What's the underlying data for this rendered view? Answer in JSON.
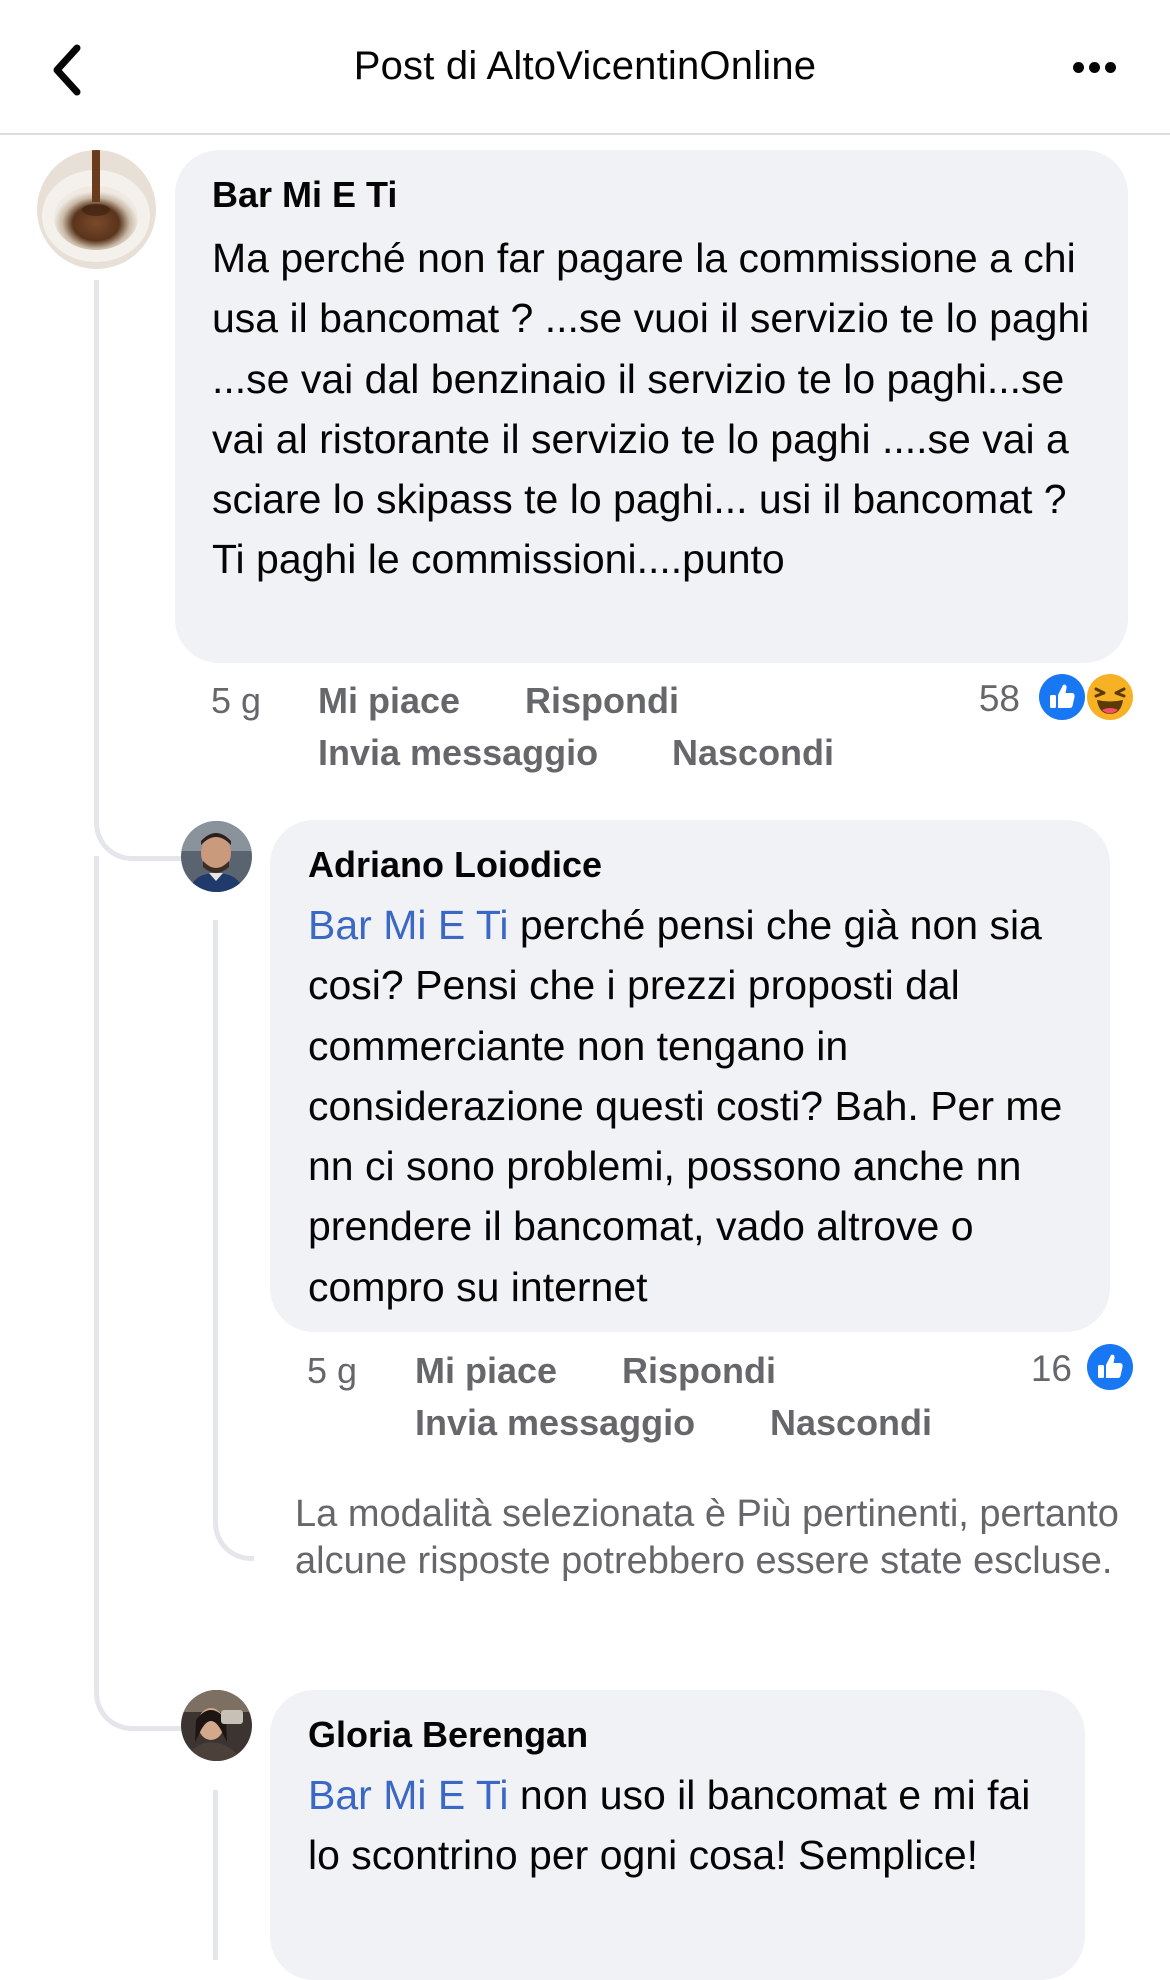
{
  "header": {
    "title": "Post di AltoVicentinOnline"
  },
  "comments": [
    {
      "author": "Bar Mi E Ti",
      "text": "Ma perché non far pagare la commissione a chi usa il bancomat ? ...se vuoi il servizio te lo paghi ...se vai dal benzinaio il servizio te lo paghi...se vai al ristorante il servizio te lo paghi ....se vai a sciare lo skipass te lo paghi... usi il bancomat ? Ti paghi le commissioni....punto",
      "time": "5 g",
      "like_label": "Mi piace",
      "reply_label": "Rispondi",
      "message_label": "Invia messaggio",
      "hide_label": "Nascondi",
      "reaction_count": "58",
      "reactions": [
        "like-icon",
        "haha-icon"
      ]
    },
    {
      "author": "Adriano Loiodice",
      "mention": "Bar Mi E Ti",
      "text": "perché pensi che già non sia cosi? Pensi che i prezzi proposti dal commerciante non tengano in considerazione questi costi? Bah. Per me nn ci sono problemi, possono anche nn prendere il bancomat, vado altrove o compro su internet",
      "time": "5 g",
      "like_label": "Mi piace",
      "reply_label": "Rispondi",
      "message_label": "Invia messaggio",
      "hide_label": "Nascondi",
      "reaction_count": "16",
      "reactions": [
        "like-icon"
      ]
    },
    {
      "author": "Gloria Berengan",
      "mention": "Bar Mi E Ti",
      "text": "non uso il bancomat e mi fai lo scontrino per ogni cosa! Semplice!"
    }
  ],
  "notice": "La modalità selezionata è Più pertinenti, pertanto alcune risposte potrebbero essere state escluse.",
  "colors": {
    "bubble": "#f0f2f5",
    "mention": "#3a68c4",
    "secondary_text": "#65676b",
    "like_blue": "#1877f2",
    "haha_yellow": "#f7b125"
  }
}
